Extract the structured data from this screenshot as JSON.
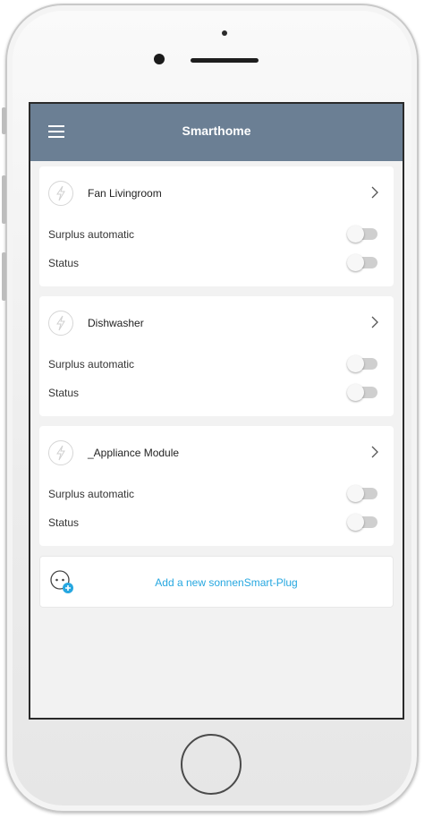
{
  "app": {
    "title": "Smarthome"
  },
  "devices": [
    {
      "name": "Fan Livingroom",
      "rows": [
        {
          "label": "Surplus automatic",
          "on": false
        },
        {
          "label": "Status",
          "on": false
        }
      ]
    },
    {
      "name": "Dishwasher",
      "rows": [
        {
          "label": "Surplus automatic",
          "on": false
        },
        {
          "label": "Status",
          "on": false
        }
      ]
    },
    {
      "name": "_Appliance Module",
      "rows": [
        {
          "label": "Surplus automatic",
          "on": false
        },
        {
          "label": "Status",
          "on": false
        }
      ]
    }
  ],
  "add_plug": {
    "label": "Add a new sonnenSmart-Plug"
  },
  "colors": {
    "appbar": "#6b7f94",
    "accent": "#26a7e0",
    "background": "#f2f2f2"
  },
  "icons": {
    "menu": "hamburger-menu-icon",
    "device": "lightning-bolt-icon",
    "chevron": "chevron-right-icon",
    "add": "smart-plug-add-icon"
  }
}
